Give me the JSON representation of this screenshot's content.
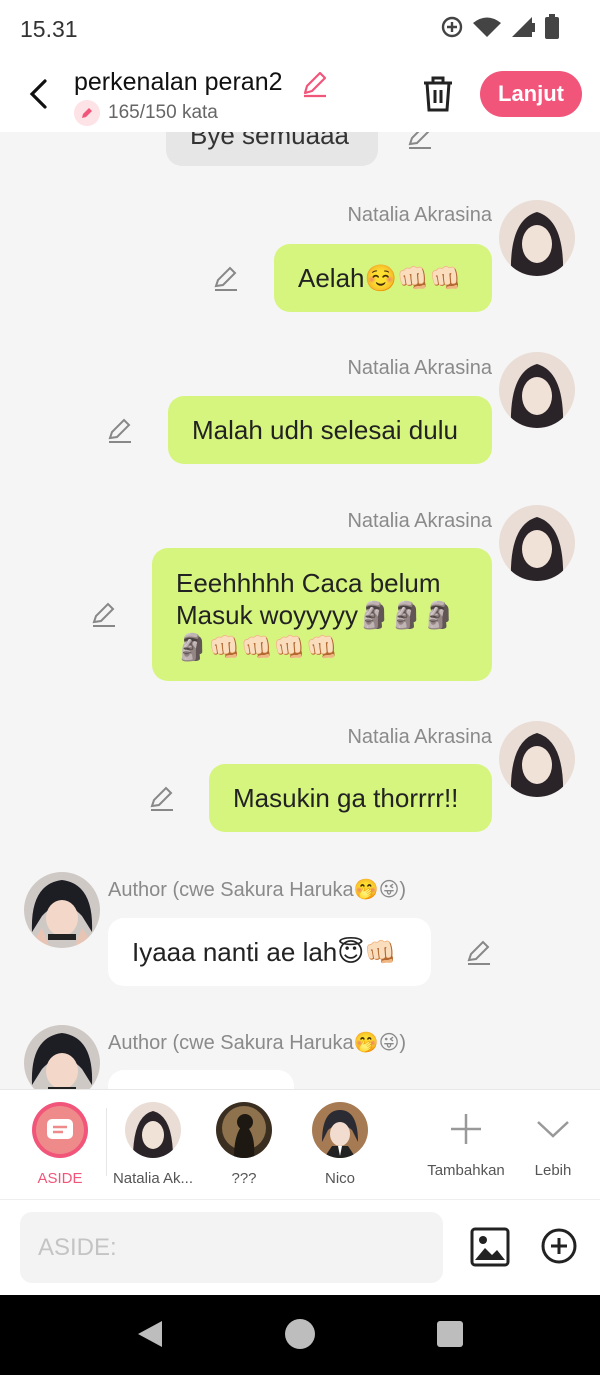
{
  "status_bar": {
    "time": "15.31"
  },
  "header": {
    "title": "perkenalan peran2",
    "word_count": "165/150 kata",
    "next_label": "Lanjut",
    "accent_color": "#f2557a"
  },
  "chat": {
    "partial_top_message": "Bye semuaaa",
    "messages": [
      {
        "sender": "Natalia Akrasina",
        "side": "right",
        "text_lines": [
          "Aelah☺️👊🏻👊🏻"
        ]
      },
      {
        "sender": "Natalia Akrasina",
        "side": "right",
        "text_lines": [
          "Malah udh selesai dulu"
        ]
      },
      {
        "sender": "Natalia Akrasina",
        "side": "right",
        "text_lines": [
          "Eeehhhhh Caca belum",
          "Masuk woyyyyy🗿🗿🗿",
          "🗿👊🏻👊🏻👊🏻👊🏻"
        ]
      },
      {
        "sender": "Natalia Akrasina",
        "side": "right",
        "text_lines": [
          "Masukin ga thorrrr!!"
        ]
      },
      {
        "sender": "Author (cwe Sakura Haruka🤭😜)",
        "side": "left",
        "text_lines": [
          "Iyaaa nanti ae lah😇👊🏻"
        ]
      },
      {
        "sender": "Author (cwe Sakura Haruka🤭😜)",
        "side": "left",
        "text_lines": [
          ""
        ]
      }
    ]
  },
  "characters": [
    {
      "label": "ASIDE",
      "icon": "message-icon",
      "active": true
    },
    {
      "label": "Natalia Ak...",
      "icon": "avatar-natalia"
    },
    {
      "label": "???",
      "icon": "avatar-unknown"
    },
    {
      "label": "Nico",
      "icon": "avatar-nico"
    }
  ],
  "char_actions": {
    "add_label": "Tambahkan",
    "more_label": "Lebih"
  },
  "input": {
    "placeholder": "ASIDE:"
  }
}
